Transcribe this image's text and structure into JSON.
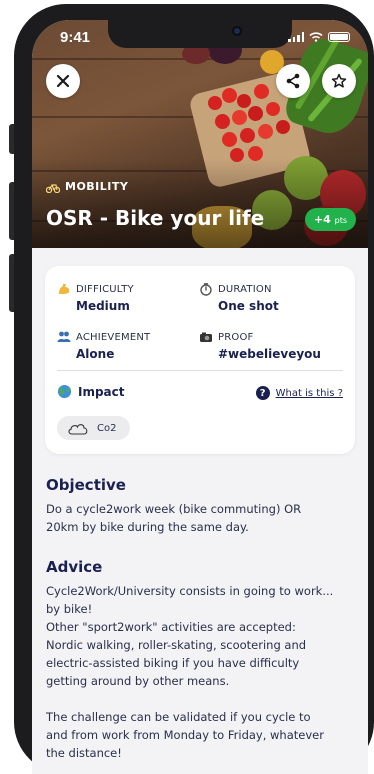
{
  "status_bar": {
    "time": "9:41"
  },
  "header": {
    "category_label": "MOBILITY",
    "title": "OSR - Bike your life",
    "points_value": "+4",
    "points_unit": "pts"
  },
  "info": {
    "difficulty": {
      "label": "DIFFICULTY",
      "value": "Medium",
      "icon": "flexed-biceps-icon"
    },
    "duration": {
      "label": "DURATION",
      "value": "One shot",
      "icon": "stopwatch-icon"
    },
    "achievement": {
      "label": "ACHIEVEMENT",
      "value": "Alone",
      "icon": "people-icon"
    },
    "proof": {
      "label": "PROOF",
      "value": "#webelieveyou",
      "icon": "camera-icon"
    },
    "impact_label": "Impact",
    "what_is_this": "What is this ?",
    "impact_chip": "Co2"
  },
  "objective": {
    "title": "Objective",
    "text": "Do a cycle2work week (bike commuting) OR\n20km by bike during the same day."
  },
  "advice": {
    "title": "Advice",
    "text": "Cycle2Work/University consists in going to work...\nby bike!\nOther  \"sport2work\" activities are accepted:\nNordic walking, roller-skating,  scootering and\nelectric-assisted biking if you have difficulty\ngetting  around by other means.\n\nThe challenge can be validated if you cycle to\nand from work from Monday to Friday, whatever\nthe distance!"
  },
  "colors": {
    "accent_green": "#21b24b",
    "title_navy": "#1a2050",
    "background": "#f3f3f5"
  }
}
